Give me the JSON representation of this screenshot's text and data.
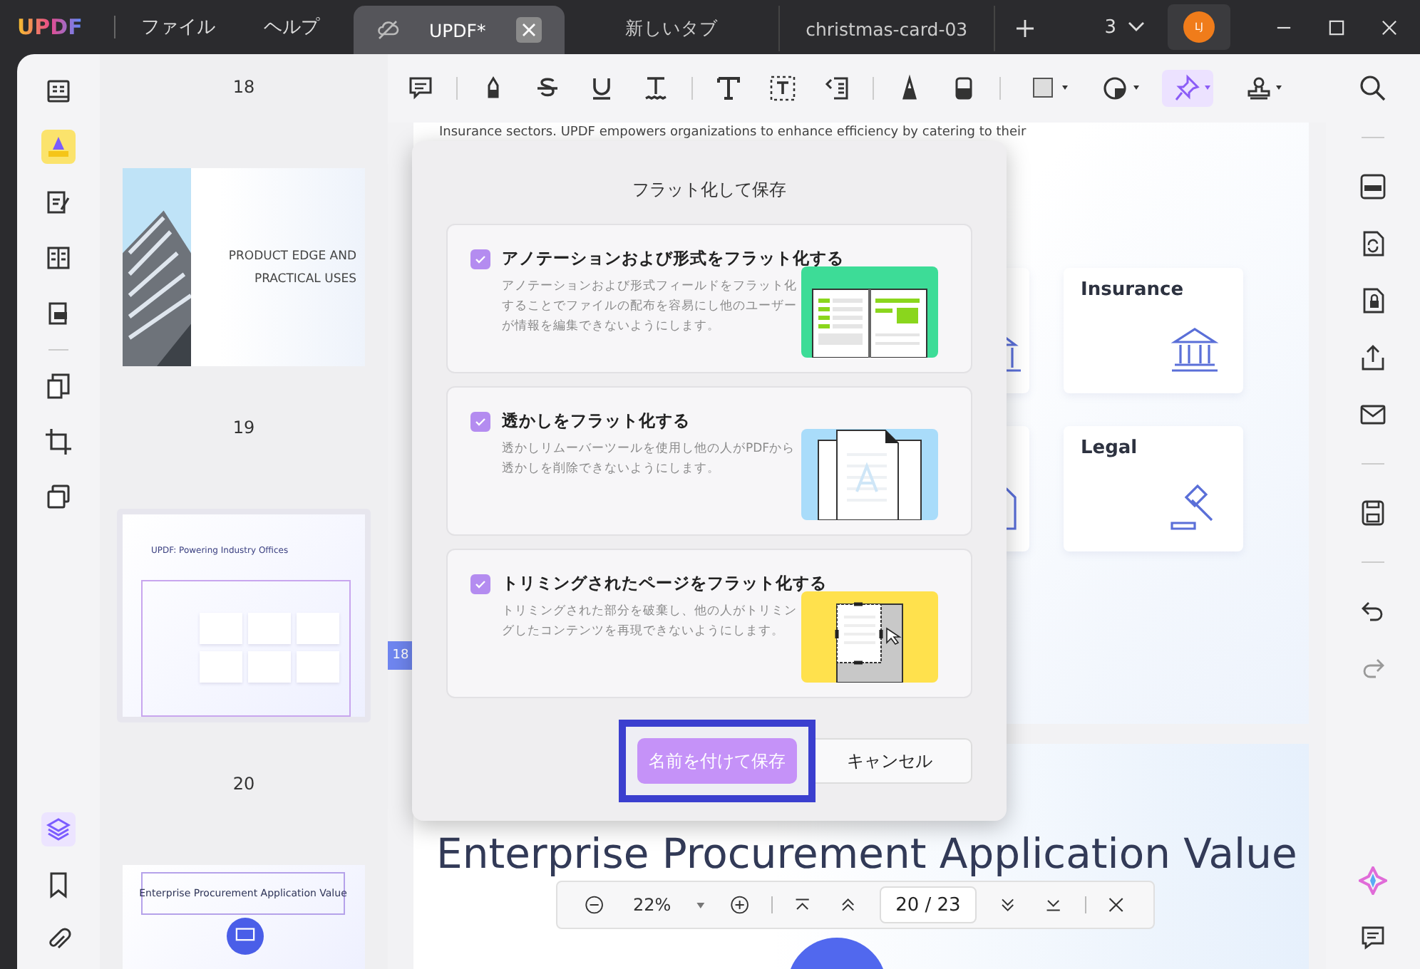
{
  "app": {
    "logo": "UPDF",
    "menu": [
      "ファイル",
      "ヘルプ"
    ]
  },
  "tabs": [
    {
      "label": "UPDF*",
      "selected": true
    },
    {
      "label": "新しいタブ",
      "selected": false
    },
    {
      "label": "christmas-card-03",
      "selected": false
    }
  ],
  "window_count": "3",
  "user": {
    "initials": "LJ"
  },
  "left_rail": [
    {
      "selected": false
    },
    {
      "selected": true
    },
    {
      "selected": false
    },
    {
      "selected": false
    },
    {
      "selected": false
    },
    {
      "selected": false
    },
    {
      "selected": false
    },
    {
      "selected": false
    },
    {
      "selected": true
    },
    {
      "selected": false
    },
    {
      "selected": false
    }
  ],
  "toolbar": [
    {
      "selected": false
    },
    {
      "selected": false
    },
    {
      "selected": false
    },
    {
      "selected": false
    },
    {
      "selected": false
    },
    {
      "selected": false
    },
    {
      "selected": false
    },
    {
      "selected": false
    },
    {
      "selected": false
    },
    {
      "selected": false
    },
    {
      "selected": false
    },
    {
      "selected": false
    },
    {
      "selected": true
    },
    {
      "selected": false
    }
  ],
  "thumbnails": [
    {
      "page": "18",
      "title": "PRODUCT EDGE AND PRACTICAL USES"
    },
    {
      "page": "19",
      "title": "UPDF: Powering Industry Offices"
    },
    {
      "page": "20",
      "title": "Enterprise Procurement Application Value"
    }
  ],
  "document": {
    "intro": "Insurance sectors. UPDF empowers organizations to enhance efficiency by catering to their",
    "cards": [
      "Insurance",
      "Legal"
    ],
    "page_tag": "18",
    "heading": "Enterprise Procurement Application Value"
  },
  "dialog": {
    "title": "フラット化して保存",
    "options": [
      {
        "kind": "annotation",
        "title": "アノテーションおよび形式をフラット化する",
        "description": "アノテーションおよび形式フィールドをフラット化することでファイルの配布を容易にし他のユーザーが情報を編集できないようにします。",
        "checked": true
      },
      {
        "kind": "watermark",
        "title": "透かしをフラット化する",
        "description": "透かしリムーバーツールを使用し他の人がPDFから透かしを削除できないようにします。",
        "checked": true
      },
      {
        "kind": "crop",
        "title": "トリミングされたページをフラット化する",
        "description": "トリミングされた部分を破棄し、他の人がトリミングしたコンテンツを再現できないようにします。",
        "checked": true
      }
    ],
    "save_button": "名前を付けて保存",
    "save_highlighted": true,
    "cancel_button": "キャンセル"
  },
  "zoom_bar": {
    "zoom": "22%",
    "page": "20 / 23"
  }
}
